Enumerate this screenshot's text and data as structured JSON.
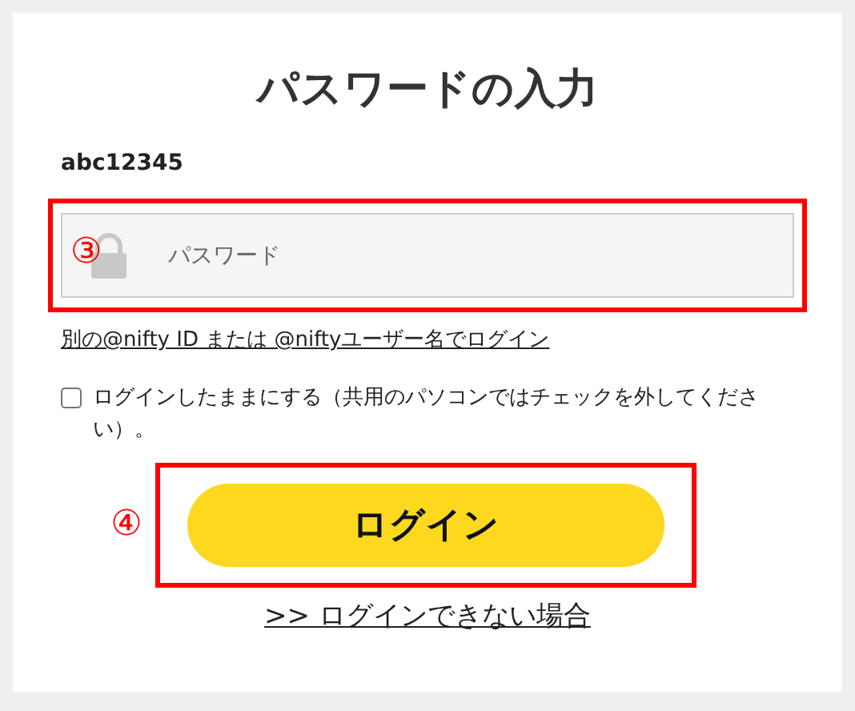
{
  "title": "パスワードの入力",
  "username": "abc12345",
  "password_field": {
    "placeholder": "パスワード",
    "marker": "③"
  },
  "alt_login_link": "別の@nifty ID または @niftyユーザー名でログイン",
  "remember": {
    "label": "ログインしたままにする（共用のパソコンではチェックを外してください）。",
    "checked": false
  },
  "login_button": {
    "label": "ログイン",
    "marker": "④"
  },
  "help_link": ">> ログインできない場合"
}
